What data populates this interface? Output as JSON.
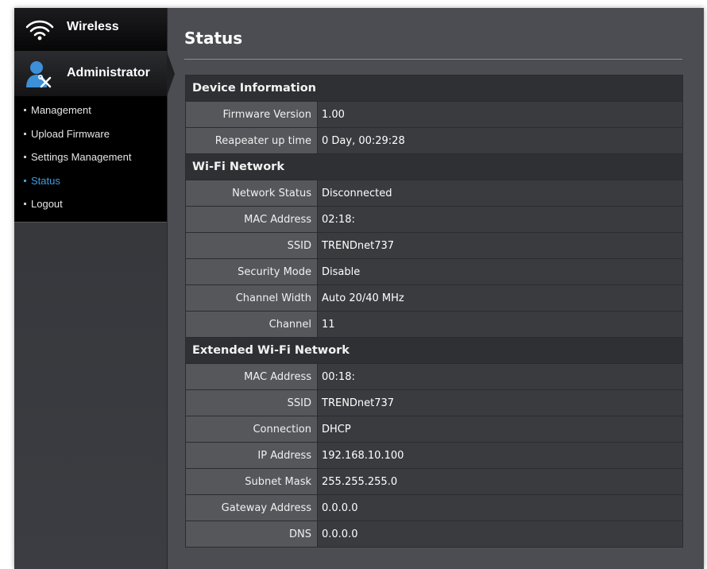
{
  "sidebar": {
    "wireless_label": "Wireless",
    "admin_label": "Administrator",
    "submenu": [
      {
        "label": "Management",
        "active": false
      },
      {
        "label": "Upload Firmware",
        "active": false
      },
      {
        "label": "Settings Management",
        "active": false
      },
      {
        "label": "Status",
        "active": true
      },
      {
        "label": "Logout",
        "active": false
      }
    ]
  },
  "main": {
    "title": "Status"
  },
  "sections": {
    "device": {
      "title": "Device Information",
      "rows": [
        {
          "label": "Firmware Version",
          "value": "1.00"
        },
        {
          "label": "Reapeater up time",
          "value": "0 Day, 00:29:28"
        }
      ]
    },
    "wifi": {
      "title": "Wi-Fi Network",
      "rows": [
        {
          "label": "Network Status",
          "value": "Disconnected"
        },
        {
          "label": "MAC Address",
          "value": "02:18:"
        },
        {
          "label": "SSID",
          "value": "TRENDnet737"
        },
        {
          "label": "Security Mode",
          "value": "Disable"
        },
        {
          "label": "Channel Width",
          "value": "Auto 20/40 MHz"
        },
        {
          "label": "Channel",
          "value": "11"
        }
      ]
    },
    "extended": {
      "title": "Extended Wi-Fi Network",
      "rows": [
        {
          "label": "MAC Address",
          "value": "00:18:"
        },
        {
          "label": "SSID",
          "value": "TRENDnet737"
        },
        {
          "label": "Connection",
          "value": "DHCP"
        },
        {
          "label": "IP Address",
          "value": "192.168.10.100"
        },
        {
          "label": "Subnet Mask",
          "value": "255.255.255.0"
        },
        {
          "label": "Gateway Address",
          "value": "0.0.0.0"
        },
        {
          "label": "DNS",
          "value": "0.0.0.0"
        }
      ]
    }
  },
  "colors": {
    "active_link": "#3aa0e6",
    "background": "#4b4d52",
    "section_header": "#2f3033"
  },
  "icons": {
    "wireless": "wifi-icon",
    "administrator": "admin-user-icon"
  }
}
